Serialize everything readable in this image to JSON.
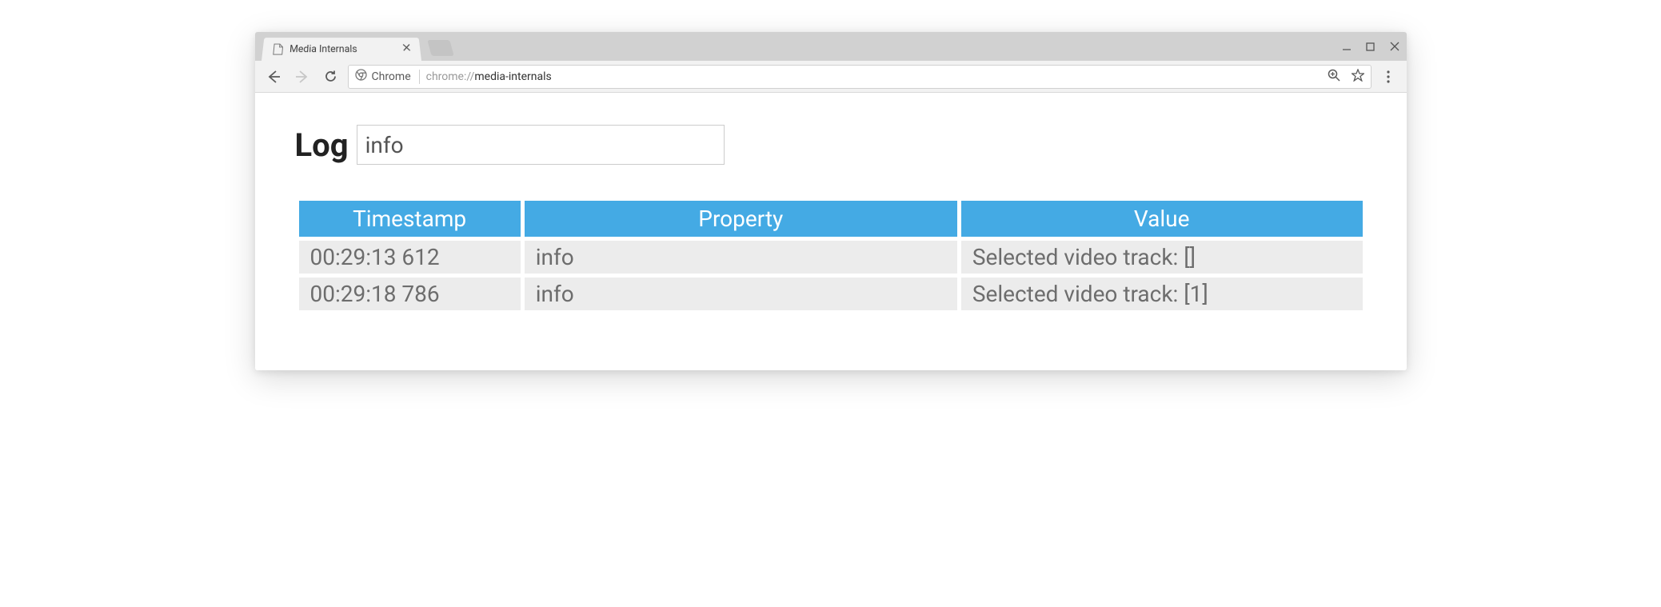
{
  "browser": {
    "tab_title": "Media Internals",
    "site_label": "Chrome",
    "url_scheme": "chrome://",
    "url_path": "media-internals"
  },
  "page": {
    "heading": "Log",
    "filter_value": "info",
    "columns": [
      "Timestamp",
      "Property",
      "Value"
    ],
    "rows": [
      {
        "timestamp": "00:29:13 612",
        "property": "info",
        "value": "Selected video track: []"
      },
      {
        "timestamp": "00:29:18 786",
        "property": "info",
        "value": "Selected video track: [1]"
      }
    ]
  }
}
